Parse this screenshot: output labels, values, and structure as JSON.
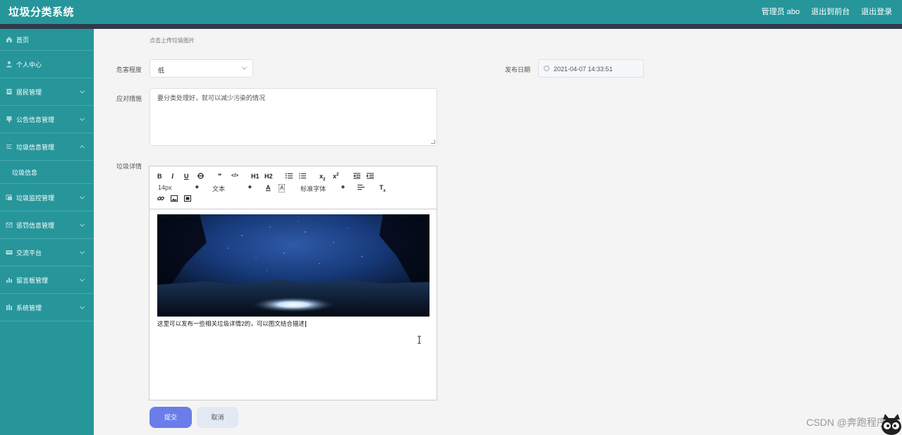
{
  "header": {
    "app_title": "垃圾分类系统",
    "admin_label": "管理员 abo",
    "back_to_front": "退出到前台",
    "logout": "退出登录"
  },
  "sidebar": {
    "items": [
      {
        "label": "首页",
        "icon": "home-icon"
      },
      {
        "label": "个人中心",
        "icon": "user-icon"
      },
      {
        "label": "居民管理",
        "icon": "resident-icon"
      },
      {
        "label": "公告信息管理",
        "icon": "notice-icon"
      },
      {
        "label": "垃圾信息管理",
        "icon": "list-icon",
        "expanded": true
      },
      {
        "label": "垃圾监控管理",
        "icon": "monitor-icon"
      },
      {
        "label": "惩罚信息管理",
        "icon": "mail-icon"
      },
      {
        "label": "交流平台",
        "icon": "chat-icon"
      },
      {
        "label": "留言板管理",
        "icon": "chart-icon"
      },
      {
        "label": "系统管理",
        "icon": "settings-icon"
      }
    ],
    "sub_item": "垃圾信息"
  },
  "form": {
    "upload_hint": "点击上传垃圾图片",
    "hazard_label": "危害程度",
    "hazard_value": "低",
    "date_label": "发布日期",
    "date_value": "2021-04-07 14:33:51",
    "measures_label": "应对措施",
    "measures_value": "要分类处理好，就可以减少污染的情况",
    "detail_label": "垃圾详情",
    "submit": "提交",
    "cancel": "取消"
  },
  "editor": {
    "font_size": "14px",
    "paragraph": "文本",
    "font_family": "标准字体",
    "h1": "H1",
    "h2": "H2",
    "content_text": "这里可以发布一些相关垃圾详情2的，可以图文结合描述"
  },
  "watermark": "CSDN @奔跑程序",
  "colors": {
    "header": "#26969b",
    "sidebar": "#26969b",
    "strip": "#2f3a4b",
    "submit_button": "#6a7de8",
    "cancel_button": "#e2e9f3"
  }
}
